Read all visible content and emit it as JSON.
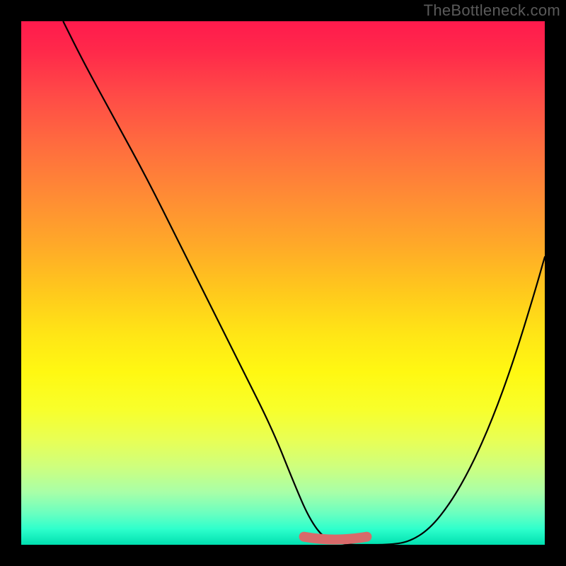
{
  "watermark": "TheBottleneck.com",
  "chart_data": {
    "type": "line",
    "title": "",
    "xlabel": "",
    "ylabel": "",
    "xlim": [
      0,
      100
    ],
    "ylim": [
      0,
      100
    ],
    "series": [
      {
        "name": "curve",
        "x": [
          8,
          12,
          18,
          24,
          30,
          36,
          42,
          48,
          52,
          55,
          58,
          62,
          66,
          70,
          74,
          78,
          82,
          86,
          90,
          94,
          98,
          100
        ],
        "values": [
          100,
          92,
          81,
          70,
          58,
          46,
          34,
          22,
          12,
          5,
          1,
          0,
          0,
          0,
          0.5,
          3,
          8,
          15,
          24,
          35,
          48,
          55
        ]
      }
    ],
    "highlight_band": {
      "name": "bottleneck-free-range",
      "x_start": 54,
      "x_end": 66,
      "y": 1
    },
    "gradient_stops": [
      {
        "pos": 0,
        "color": "#ff1a4d"
      },
      {
        "pos": 50,
        "color": "#ffca1c"
      },
      {
        "pos": 75,
        "color": "#f8ff2a"
      },
      {
        "pos": 100,
        "color": "#00e0b0"
      }
    ]
  }
}
